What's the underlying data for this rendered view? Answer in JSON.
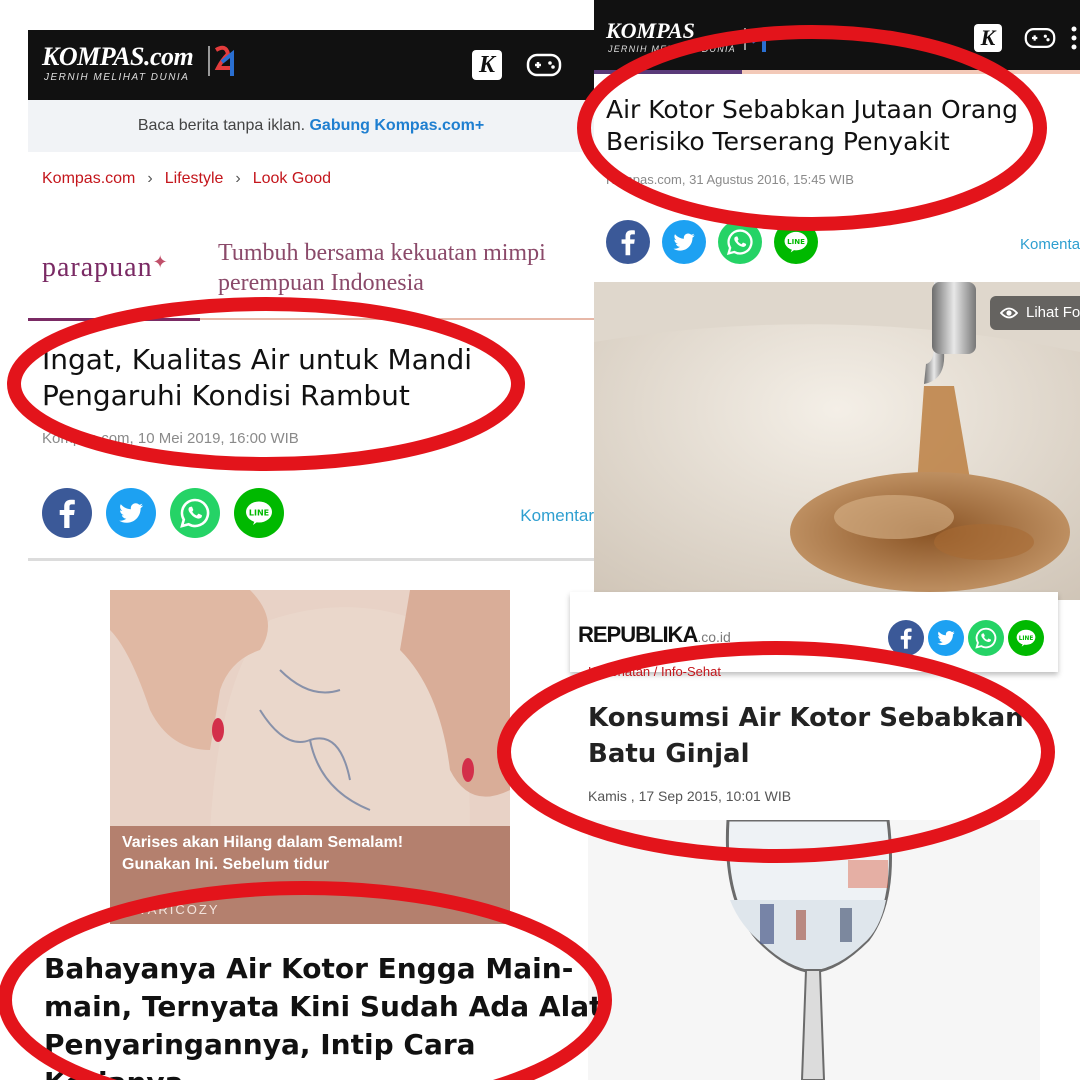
{
  "panel_a": {
    "brand_logo": "KOMPAS.com",
    "brand_tagline": "JERNIH MELIHAT DUNIA",
    "k_badge": "K",
    "ad_bar_text": "Baca berita tanpa iklan.",
    "ad_bar_link": "Gabung Kompas.com+",
    "breadcrumb": [
      "Kompas.com",
      "Lifestyle",
      "Look Good"
    ],
    "partner_logo": "parapuan",
    "partner_tagline_1": "Tumbuh bersama kekuatan mimpi",
    "partner_tagline_2": "perempuan Indonesia",
    "headline_1": "Ingat, Kualitas Air untuk Mandi",
    "headline_2": "Pengaruhi Kondisi Rambut",
    "meta": "Kompas.com, 10 Mei 2019, 16:00 WIB",
    "komentar": "Komentar"
  },
  "panel_b": {
    "brand_logo": "KOMPAS",
    "brand_tagline": "JERNIH MELIHAT DUNIA",
    "k_badge": "K",
    "headline_1": "Air Kotor Sebabkan Jutaan Orang",
    "headline_2": "Berisiko Terserang Penyakit",
    "meta": "Kompas.com, 31 Agustus 2016, 15:45 WIB",
    "komentar": "Komentar",
    "photo_button": "Lihat Foto"
  },
  "ad_c": {
    "title_line_1": "Varises akan Hilang dalam Semalam!",
    "title_line_2": "Gunakan Ini. Sebelum tidur",
    "brand": "VARICOZY"
  },
  "panel_d": {
    "brand_logo": "REPUBLIKA",
    "brand_suffix": ".co.id",
    "category": "Kesehatan / Info-Sehat",
    "headline_1": "Konsumsi Air Kotor Sebabkan",
    "headline_2": "Batu Ginjal",
    "meta": "Kamis , 17 Sep 2015, 10:01 WIB"
  },
  "bottom": {
    "headline_1": "Bahayanya Air Kotor Engga Main-",
    "headline_2": "main, Ternyata Kini Sudah Ada Alat",
    "headline_3": "Penyaringannya, Intip Cara Kerjanya"
  },
  "colors": {
    "highlight_red": "#e3141b",
    "kompas_red": "#c4161c",
    "link_blue": "#1f7fd0",
    "facebook": "#3b5998",
    "twitter": "#1da1f2",
    "whatsapp": "#25d366",
    "line": "#00b900"
  }
}
